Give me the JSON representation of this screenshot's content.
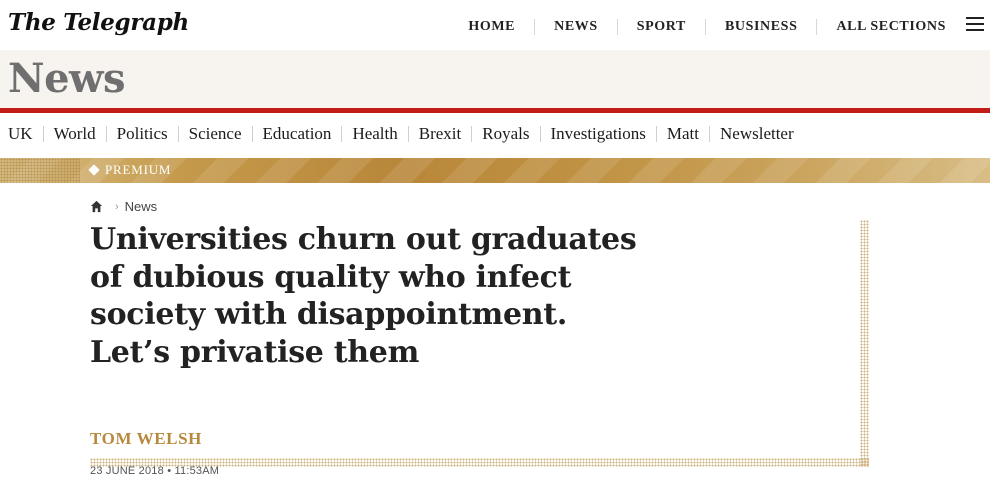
{
  "brand": {
    "logo_text": "The Telegraph"
  },
  "topnav": {
    "items": [
      "HOME",
      "NEWS",
      "SPORT",
      "BUSINESS",
      "ALL SECTIONS"
    ]
  },
  "section": {
    "title": "News",
    "rule_color": "#c31c17"
  },
  "subnav": {
    "items": [
      "UK",
      "World",
      "Politics",
      "Science",
      "Education",
      "Health",
      "Brexit",
      "Royals",
      "Investigations",
      "Matt",
      "Newsletter"
    ]
  },
  "premium": {
    "label": "PREMIUM",
    "accent": "#c59a4c"
  },
  "breadcrumb": {
    "home_icon": "home-icon",
    "current": "News"
  },
  "article": {
    "headline": "Universities churn out graduates of dubious quality who infect society with disappointment. Let’s privatise them",
    "author": "TOM WELSH",
    "date": "23 JUNE 2018 • 11:53AM",
    "author_color": "#b8893d"
  }
}
